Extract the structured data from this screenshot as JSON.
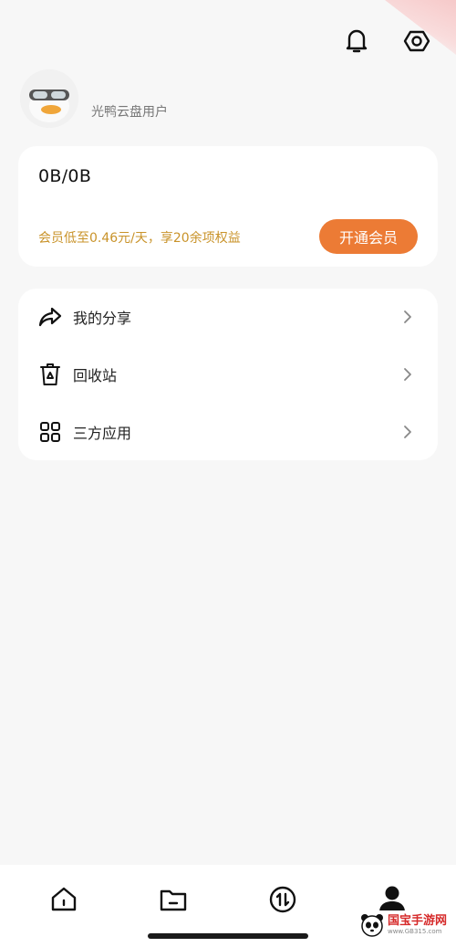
{
  "header": {
    "notification_icon": "bell-icon",
    "settings_icon": "settings-icon"
  },
  "profile": {
    "username": "光鸭云盘用户"
  },
  "storage": {
    "usage": "0B/0B",
    "promo_text": "会员低至0.46元/天，享20余项权益",
    "vip_button": "开通会员"
  },
  "menu": {
    "items": [
      {
        "label": "我的分享",
        "icon": "share-icon"
      },
      {
        "label": "回收站",
        "icon": "recycle-bin-icon"
      },
      {
        "label": "三方应用",
        "icon": "apps-grid-icon"
      }
    ]
  },
  "bottom_nav": {
    "items": [
      {
        "icon": "home-icon",
        "active": false
      },
      {
        "icon": "folder-icon",
        "active": false
      },
      {
        "icon": "transfer-icon",
        "active": false
      },
      {
        "icon": "profile-icon",
        "active": true
      }
    ]
  },
  "watermark": {
    "title": "国宝手游网",
    "url": "www.GB315.com"
  },
  "colors": {
    "accent": "#ec7b35",
    "promo": "#c9932a",
    "background": "#f7f7f7"
  }
}
